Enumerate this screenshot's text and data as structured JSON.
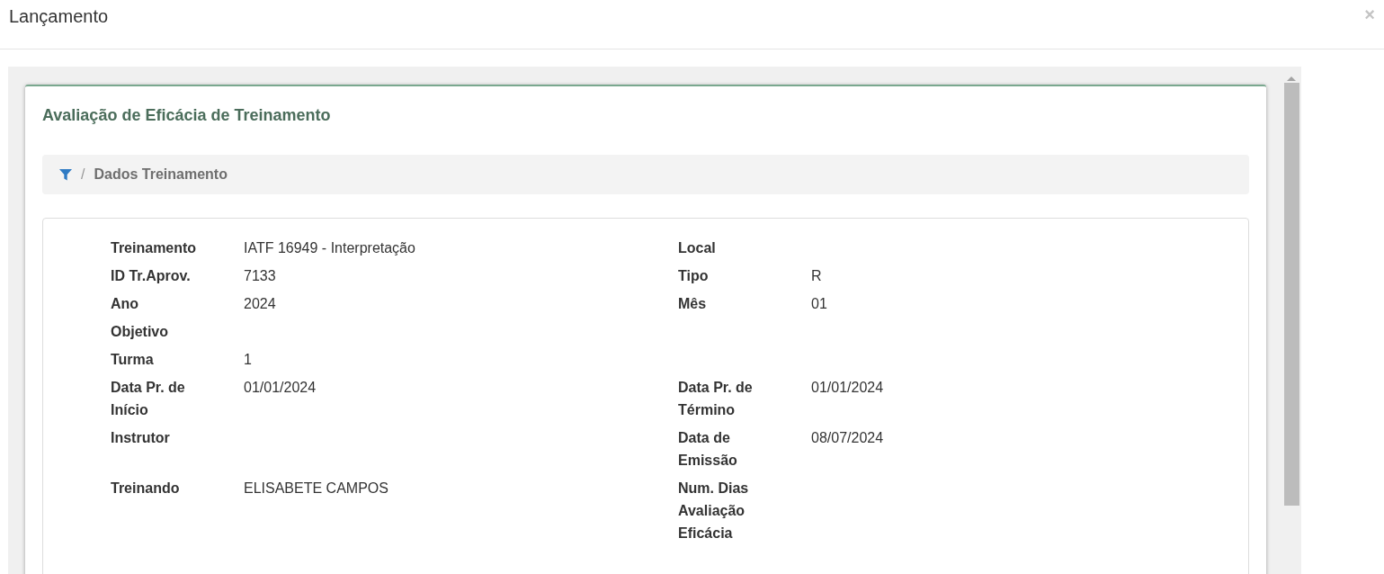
{
  "dialog": {
    "title": "Lançamento",
    "close": "×"
  },
  "card": {
    "title": "Avaliação de Eficácia de Treinamento",
    "breadcrumb": {
      "separator": "/",
      "items": [
        "Dados Treinamento"
      ]
    },
    "rows": [
      {
        "left": {
          "label": "Treinamento",
          "value": "IATF 16949 - Interpretação"
        },
        "right": {
          "label": "Local"
        }
      },
      {
        "left": {
          "label": "ID Tr.Aprov.",
          "value": "7133"
        },
        "right": {
          "label": "Tipo",
          "value": "R"
        }
      },
      {
        "left": {
          "label": "Ano",
          "value": "2024"
        },
        "right": {
          "label": "Mês",
          "value": "01"
        }
      },
      {
        "left": {
          "label": "Objetivo"
        }
      },
      {
        "left": {
          "label": "Turma",
          "value": "1"
        }
      },
      {
        "left": {
          "label": "Data Pr. de Início",
          "value": "01/01/2024"
        },
        "right": {
          "label": "Data Pr. de Término",
          "value": "01/01/2024"
        }
      },
      {
        "left": {
          "label": "Instrutor"
        },
        "right": {
          "label": "Data de Emissão",
          "value": "08/07/2024"
        }
      },
      {
        "left": {
          "label": "Treinando",
          "value": "ELISABETE CAMPOS"
        },
        "right": {
          "label": "Num. Dias Avaliação Eficácia"
        }
      }
    ]
  }
}
